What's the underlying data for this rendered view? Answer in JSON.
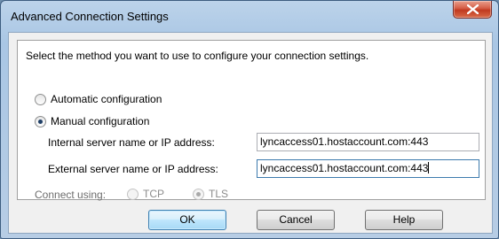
{
  "window": {
    "title": "Advanced Connection Settings"
  },
  "intro_text": "Select the method you want to use to configure your connection settings.",
  "options": {
    "automatic_label": "Automatic configuration",
    "manual_label": "Manual configuration",
    "selected": "manual"
  },
  "internal": {
    "label": "Internal server name or IP address:",
    "value": "lyncaccess01.hostaccount.com:443"
  },
  "external": {
    "label": "External server name or IP address:",
    "value": "lyncaccess01.hostaccount.com:443"
  },
  "connect": {
    "label": "Connect using:",
    "tcp_label": "TCP",
    "tls_label": "TLS",
    "selected": "TLS",
    "enabled": false
  },
  "buttons": {
    "ok": "OK",
    "cancel": "Cancel",
    "help": "Help"
  },
  "colors": {
    "default_button_border": "#3c7fb1",
    "close_button": "#c0391f"
  }
}
